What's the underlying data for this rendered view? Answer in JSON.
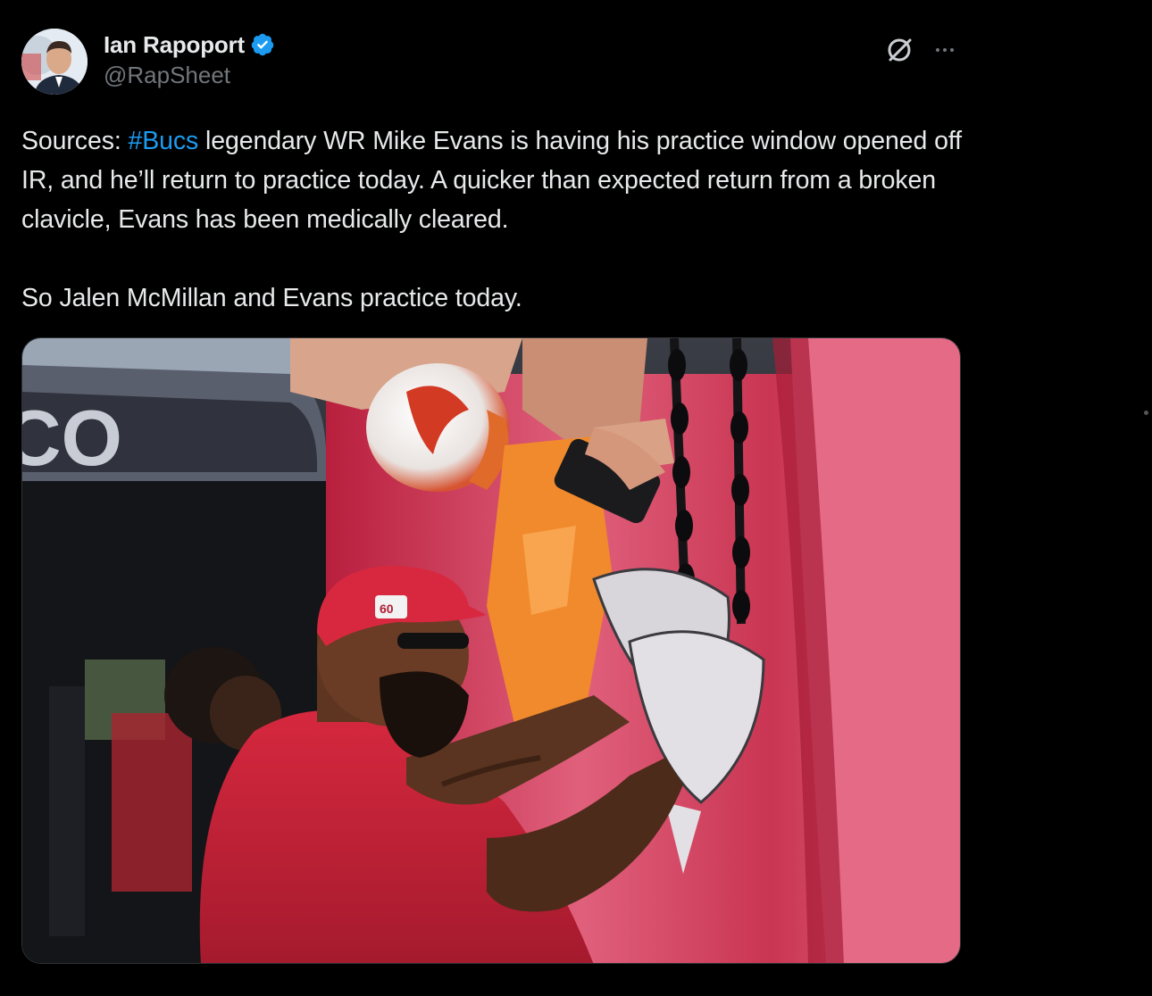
{
  "author": {
    "display_name": "Ian Rapoport",
    "handle": "@RapSheet",
    "verified": true,
    "avatar_icon": "avatar-photo"
  },
  "actions": {
    "grok_icon": "grok-icon",
    "more_icon": "more-icon"
  },
  "tweet": {
    "line1_prefix": "Sources: ",
    "hashtag": "#Bucs",
    "line1_rest": " legendary WR Mike Evans is having his practice window opened off IR, and he’ll return to practice today. A quicker than expected return from a broken clavicle, Evans has been medically cleared.",
    "paragraph2": "So Jalen McMillan and Evans practice today."
  },
  "media": {
    "type": "photo",
    "banner_text": "CO"
  },
  "colors": {
    "background": "#000000",
    "text": "#e7e9ea",
    "secondary": "#71767b",
    "accent": "#1d9bf0",
    "verified": "#1d9bf0"
  }
}
